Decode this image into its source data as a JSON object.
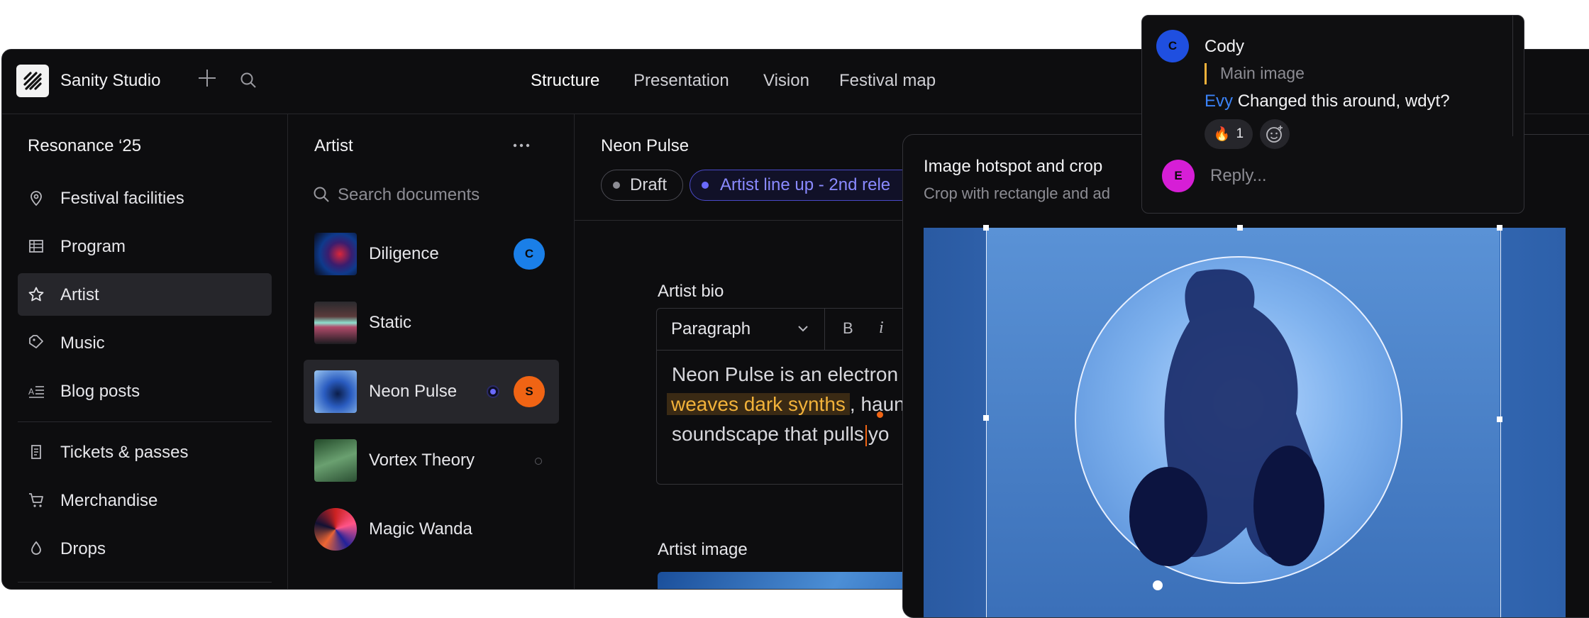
{
  "app": {
    "title": "Sanity Studio"
  },
  "nav": {
    "items": [
      "Structure",
      "Presentation",
      "Vision",
      "Festival map"
    ]
  },
  "sidebar": {
    "title": "Resonance ‘25",
    "items": [
      {
        "label": "Festival facilities",
        "icon": "map-pin-icon"
      },
      {
        "label": "Program",
        "icon": "table-icon"
      },
      {
        "label": "Artist",
        "icon": "star-icon",
        "selected": true
      },
      {
        "label": "Music",
        "icon": "tag-icon"
      },
      {
        "label": "Blog posts",
        "icon": "text-lines-icon"
      }
    ],
    "items2": [
      {
        "label": "Tickets & passes",
        "icon": "scroll-icon"
      },
      {
        "label": "Merchandise",
        "icon": "cart-icon"
      },
      {
        "label": "Drops",
        "icon": "drop-icon"
      }
    ]
  },
  "artist_list": {
    "title": "Artist",
    "search_placeholder": "Search documents",
    "items": [
      {
        "name": "Diligence",
        "avatar": "C"
      },
      {
        "name": "Static",
        "avatar": ""
      },
      {
        "name": "Neon Pulse",
        "avatar": "S",
        "selected": true
      },
      {
        "name": "Vortex Theory",
        "avatar": ""
      },
      {
        "name": "Magic Wanda",
        "avatar": ""
      }
    ]
  },
  "document": {
    "title": "Neon Pulse",
    "status_draft": "Draft",
    "status_release": "Artist line up - 2nd rele",
    "bio_label": "Artist bio",
    "style_select": "Paragraph",
    "bold": "B",
    "italic": "i",
    "bio_line1": "Neon Pulse is an electron",
    "bio_highlight": "weaves dark synths",
    "bio_line2_rest": ", haun",
    "bio_line3_a": "soundscape that pulls",
    "bio_line3_b": "yo",
    "image_label": "Artist image"
  },
  "hotspot": {
    "title": "Image hotspot and crop",
    "subtitle": "Crop with rectangle and ad"
  },
  "comment": {
    "author": "Cody",
    "author_initial": "C",
    "field": "Main image",
    "mention": "Evy",
    "text": "Changed this around, wdyt?",
    "reaction_emoji": "🔥",
    "reaction_count": "1",
    "reply_initial": "E",
    "reply_placeholder": "Reply..."
  },
  "colors": {
    "avatar_c": "#1a7fe8",
    "avatar_s": "#f06414",
    "avatar_cody": "#1f4fe0",
    "avatar_e": "#d61ed6",
    "release_accent": "#6a6aff",
    "highlight": "#f2b23a"
  }
}
